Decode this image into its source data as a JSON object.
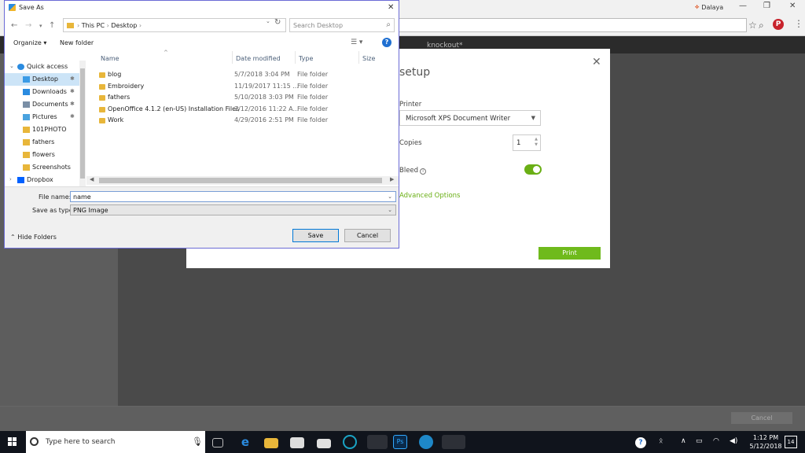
{
  "browser": {
    "user_name": "Dalaya",
    "colors": {
      "accent_pinterest": "#c8232c"
    }
  },
  "app": {
    "brand": "knockout*",
    "bottom_cancel": "Cancel"
  },
  "print_setup": {
    "title": "setup",
    "printer_label": "Printer",
    "printer_value": "Microsoft XPS Document Writer",
    "copies_label": "Copies",
    "copies_value": "1",
    "bleed_label": "Bleed",
    "bleed_on": true,
    "advanced_link": "Advanced Options",
    "print_button": "Print",
    "colors": {
      "accent": "#6fba1c"
    }
  },
  "save_dialog": {
    "title": "Save As",
    "breadcrumb": [
      "This PC",
      "Desktop"
    ],
    "search_placeholder": "Search Desktop",
    "toolbar": {
      "organize": "Organize",
      "new_folder": "New folder"
    },
    "nav_tree": [
      {
        "label": "Quick access",
        "icon": "star-icon",
        "pinned": false,
        "selected": false
      },
      {
        "label": "Desktop",
        "icon": "desktop-icon",
        "pinned": true,
        "selected": true
      },
      {
        "label": "Downloads",
        "icon": "download-icon",
        "pinned": true,
        "selected": false
      },
      {
        "label": "Documents",
        "icon": "document-icon",
        "pinned": true,
        "selected": false
      },
      {
        "label": "Pictures",
        "icon": "picture-icon",
        "pinned": true,
        "selected": false
      },
      {
        "label": "101PHOTO",
        "icon": "folder-icon",
        "pinned": false,
        "selected": false
      },
      {
        "label": "fathers",
        "icon": "folder-icon",
        "pinned": false,
        "selected": false
      },
      {
        "label": "flowers",
        "icon": "folder-icon",
        "pinned": false,
        "selected": false
      },
      {
        "label": "Screenshots",
        "icon": "folder-icon",
        "pinned": false,
        "selected": false
      },
      {
        "label": "Dropbox",
        "icon": "dropbox-icon",
        "pinned": false,
        "selected": false
      }
    ],
    "columns": {
      "name": "Name",
      "date": "Date modified",
      "type": "Type",
      "size": "Size"
    },
    "files": [
      {
        "name": "blog",
        "date": "5/7/2018 3:04 PM",
        "type": "File folder"
      },
      {
        "name": "Embroidery",
        "date": "11/19/2017 11:15 ...",
        "type": "File folder"
      },
      {
        "name": "fathers",
        "date": "5/10/2018 3:03 PM",
        "type": "File folder"
      },
      {
        "name": "OpenOffice 4.1.2 (en-US) Installation Files",
        "date": "7/12/2016 11:22 A...",
        "type": "File folder"
      },
      {
        "name": "Work",
        "date": "4/29/2016 2:51 PM",
        "type": "File folder"
      }
    ],
    "file_name_label": "File name:",
    "file_name_value": "name",
    "save_type_label": "Save as type:",
    "save_type_value": "PNG Image",
    "hide_folders": "Hide Folders",
    "save_button": "Save",
    "cancel_button": "Cancel"
  },
  "taskbar": {
    "search_placeholder": "Type here to search",
    "time": "1:12 PM",
    "date": "5/12/2018",
    "notifications": "14"
  }
}
